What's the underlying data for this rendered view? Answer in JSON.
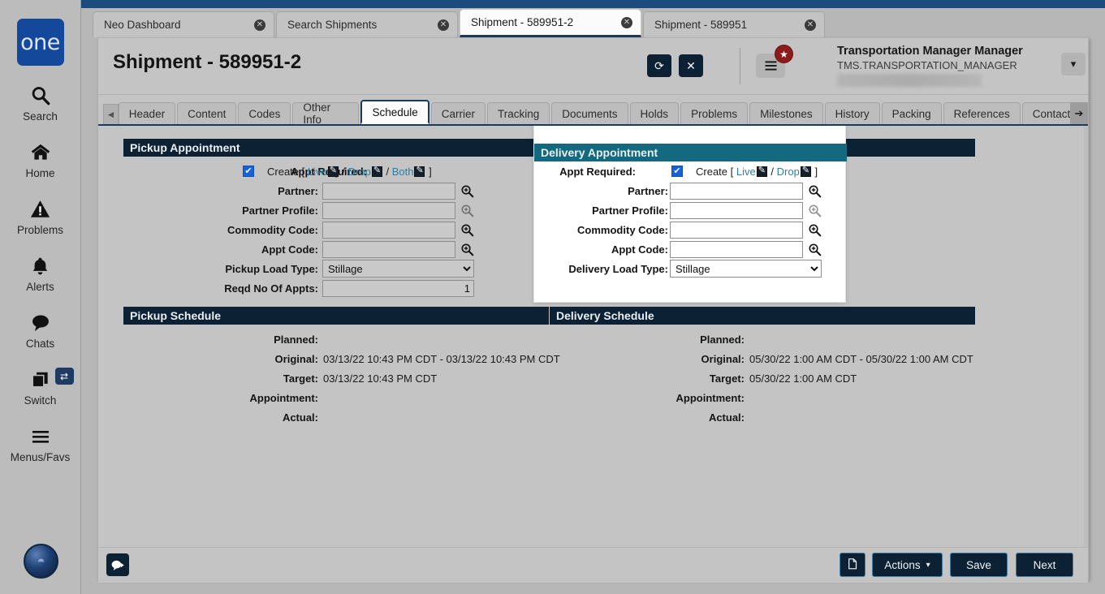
{
  "sidebar": {
    "logo_text": "one",
    "items": [
      {
        "label": "Search",
        "icon": "search-icon"
      },
      {
        "label": "Home",
        "icon": "home-icon"
      },
      {
        "label": "Problems",
        "icon": "warning-triangle-icon"
      },
      {
        "label": "Alerts",
        "icon": "bell-icon"
      },
      {
        "label": "Chats",
        "icon": "chat-bubble-icon"
      },
      {
        "label": "Switch",
        "icon": "windows-stack-icon",
        "badge_icon": "swap-arrows-icon"
      },
      {
        "label": "Menus/Favs",
        "icon": "hamburger-icon"
      }
    ]
  },
  "browser_tabs": [
    {
      "label": "Neo Dashboard",
      "active": false
    },
    {
      "label": "Search Shipments",
      "active": false
    },
    {
      "label": "Shipment - 589951-2",
      "active": true
    },
    {
      "label": "Shipment - 589951",
      "active": false
    }
  ],
  "header": {
    "title": "Shipment - 589951-2",
    "refresh_icon": "refresh-icon",
    "close_icon": "close-x-icon",
    "menu_icon": "hamburger-icon",
    "star_badge_icon": "star-icon",
    "user_name": "Transportation Manager Manager",
    "user_login": "TMS.TRANSPORTATION_MANAGER",
    "caret_icon": "chevron-down-icon"
  },
  "tabs": {
    "left_arrow_icon": "arrow-left-icon",
    "right_arrow_icon": "arrow-right-icon",
    "items": [
      {
        "label": "Header",
        "active": false
      },
      {
        "label": "Content",
        "active": false
      },
      {
        "label": "Codes",
        "active": false
      },
      {
        "label": "Other Info",
        "active": false
      },
      {
        "label": "Schedule",
        "active": true
      },
      {
        "label": "Carrier",
        "active": false
      },
      {
        "label": "Tracking",
        "active": false
      },
      {
        "label": "Documents",
        "active": false
      },
      {
        "label": "Holds",
        "active": false
      },
      {
        "label": "Problems",
        "active": false
      },
      {
        "label": "Milestones",
        "active": false
      },
      {
        "label": "History",
        "active": false
      },
      {
        "label": "Packing",
        "active": false
      },
      {
        "label": "References",
        "active": false
      },
      {
        "label": "Contacts",
        "active": false
      }
    ]
  },
  "pickup_appointment": {
    "section_title": "Pickup Appointment",
    "appt_required_label": "Appt Required:",
    "appt_required_checked": true,
    "create_label": "Create",
    "create_open": "[",
    "create_close": "]",
    "create_options": [
      "Live",
      "Drop",
      "Both"
    ],
    "partner_label": "Partner:",
    "partner_value": "",
    "partner_profile_label": "Partner Profile:",
    "partner_profile_value": "",
    "commodity_code_label": "Commodity Code:",
    "commodity_code_value": "",
    "appt_code_label": "Appt Code:",
    "appt_code_value": "",
    "load_type_label": "Pickup Load Type:",
    "load_type_value": "Stillage",
    "reqd_appts_label": "Reqd No Of Appts:",
    "reqd_appts_value": "1",
    "lookup_icon": "magnifier-plus-icon"
  },
  "delivery_appointment": {
    "section_title": "Delivery Appointment",
    "appt_required_label": "Appt Required:",
    "appt_required_checked": true,
    "create_label": "Create",
    "create_open": "[",
    "create_close": "]",
    "create_options": [
      "Live",
      "Drop"
    ],
    "partner_label": "Partner:",
    "partner_value": "",
    "partner_profile_label": "Partner Profile:",
    "partner_profile_value": "",
    "commodity_code_label": "Commodity Code:",
    "commodity_code_value": "",
    "appt_code_label": "Appt Code:",
    "appt_code_value": "",
    "load_type_label": "Delivery Load Type:",
    "load_type_value": "Stillage",
    "lookup_icon": "magnifier-plus-icon"
  },
  "pickup_schedule": {
    "section_title": "Pickup Schedule",
    "rows": [
      {
        "label": "Planned:",
        "value": ""
      },
      {
        "label": "Original:",
        "value": "03/13/22 10:43 PM CDT - 03/13/22 10:43 PM CDT"
      },
      {
        "label": "Target:",
        "value": "03/13/22 10:43 PM CDT"
      },
      {
        "label": "Appointment:",
        "value": ""
      },
      {
        "label": "Actual:",
        "value": ""
      }
    ]
  },
  "delivery_schedule": {
    "section_title": "Delivery Schedule",
    "rows": [
      {
        "label": "Planned:",
        "value": ""
      },
      {
        "label": "Original:",
        "value": "05/30/22 1:00 AM CDT - 05/30/22 1:00 AM CDT"
      },
      {
        "label": "Target:",
        "value": "05/30/22 1:00 AM CDT"
      },
      {
        "label": "Appointment:",
        "value": ""
      },
      {
        "label": "Actual:",
        "value": ""
      }
    ]
  },
  "footer": {
    "chat_icon": "chat-bubble-icon",
    "copy_icon": "copy-document-icon",
    "actions_label": "Actions",
    "actions_caret": "▾",
    "save_label": "Save",
    "next_label": "Next"
  },
  "colors": {
    "section_header": "#0d2135",
    "section_header_teal": "#13697e",
    "accent_blue": "#14489b",
    "link": "#2d7fa8",
    "badge_red": "#8c1b1b",
    "checkbox_blue": "#1760d6",
    "tab_underline": "#1b3a5c"
  }
}
